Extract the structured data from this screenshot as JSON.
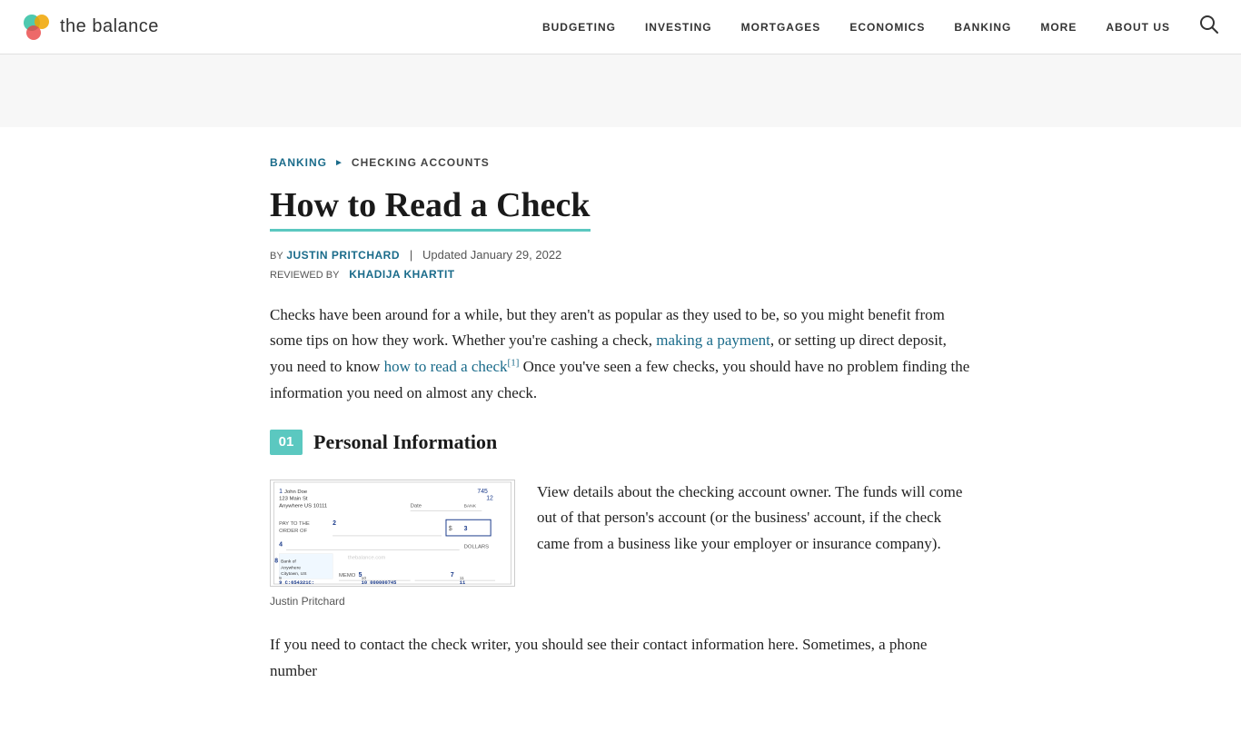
{
  "site": {
    "logo_text": "the balance",
    "logo_icon": "balance-logo"
  },
  "nav": {
    "items": [
      {
        "label": "BUDGETING",
        "id": "nav-budgeting"
      },
      {
        "label": "INVESTING",
        "id": "nav-investing"
      },
      {
        "label": "MORTGAGES",
        "id": "nav-mortgages"
      },
      {
        "label": "ECONOMICS",
        "id": "nav-economics"
      },
      {
        "label": "BANKING",
        "id": "nav-banking"
      },
      {
        "label": "MORE",
        "id": "nav-more"
      },
      {
        "label": "ABOUT US",
        "id": "nav-about-us"
      }
    ]
  },
  "breadcrumb": {
    "parent": "BANKING",
    "current": "CHECKING ACCOUNTS"
  },
  "article": {
    "title": "How to Read a Check",
    "author_label": "BY",
    "author_name": "JUSTIN PRITCHARD",
    "updated_text": "Updated January 29, 2022",
    "reviewer_label": "REVIEWED BY",
    "reviewer_name": "KHADIJA KHARTIT",
    "intro_text": "Checks have been around for a while, but they aren't as popular as they used to be, so you might benefit from some tips on how they work. Whether you're cashing a check,",
    "intro_link1": "making a payment",
    "intro_mid": ", or setting up direct deposit, you need to know",
    "intro_link2": "how to read a check",
    "intro_footnote": "[1]",
    "intro_end": " Once you've seen a few checks, you should have no problem finding the information you need on almost any check.",
    "section1": {
      "number": "01",
      "title": "Personal Information",
      "image_caption": "Justin Pritchard",
      "text1": "View details about the checking account owner. The funds will come out of that person's account (or the business' account, if the check came from a business like your employer or insurance company).",
      "text2": "If you need to contact the check writer, you should see their contact information here. Sometimes, a phone number"
    }
  }
}
